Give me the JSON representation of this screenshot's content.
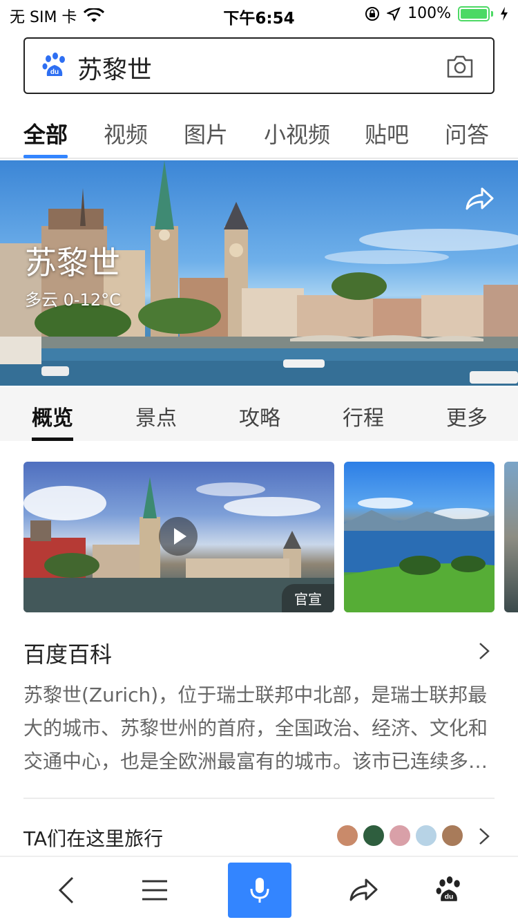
{
  "status_bar": {
    "carrier": "无 SIM 卡",
    "time": "下午6:54",
    "battery": "100%",
    "battery_level": 1.0
  },
  "search": {
    "query": "苏黎世",
    "brand_icon": "baidu-paw-icon",
    "camera_icon": "camera-icon"
  },
  "tabs": [
    {
      "label": "全部",
      "active": true
    },
    {
      "label": "视频"
    },
    {
      "label": "图片"
    },
    {
      "label": "小视频"
    },
    {
      "label": "贴吧"
    },
    {
      "label": "问答"
    }
  ],
  "hero": {
    "title": "苏黎世",
    "weather": "多云 0-12°C",
    "share_icon": "share-icon"
  },
  "subtabs": [
    {
      "label": "概览",
      "active": true
    },
    {
      "label": "景点"
    },
    {
      "label": "攻略"
    },
    {
      "label": "行程"
    },
    {
      "label": "更多"
    }
  ],
  "media": {
    "video_badge": "官宣",
    "play_icon": "play-icon"
  },
  "baike": {
    "title": "百度百科",
    "description": "苏黎世(Zurich)，位于瑞士联邦中北部，是瑞士联邦最大的城市、苏黎世州的首府，全国政治、经济、文化和交通中心，也是全欧洲最富有的城市。该市已连续多年被评为全球最宜居的城市之一。"
  },
  "travel": {
    "title": "TA们在这里旅行",
    "avatar_colors": [
      "#c98a6a",
      "#2e5e3e",
      "#d9a0a8",
      "#b7d3e6",
      "#a87b5a"
    ]
  },
  "bottom_bar": {
    "icons": [
      "back-icon",
      "menu-icon",
      "microphone-icon",
      "share-icon",
      "baidu-home-icon"
    ],
    "accent": "#3385ff"
  }
}
